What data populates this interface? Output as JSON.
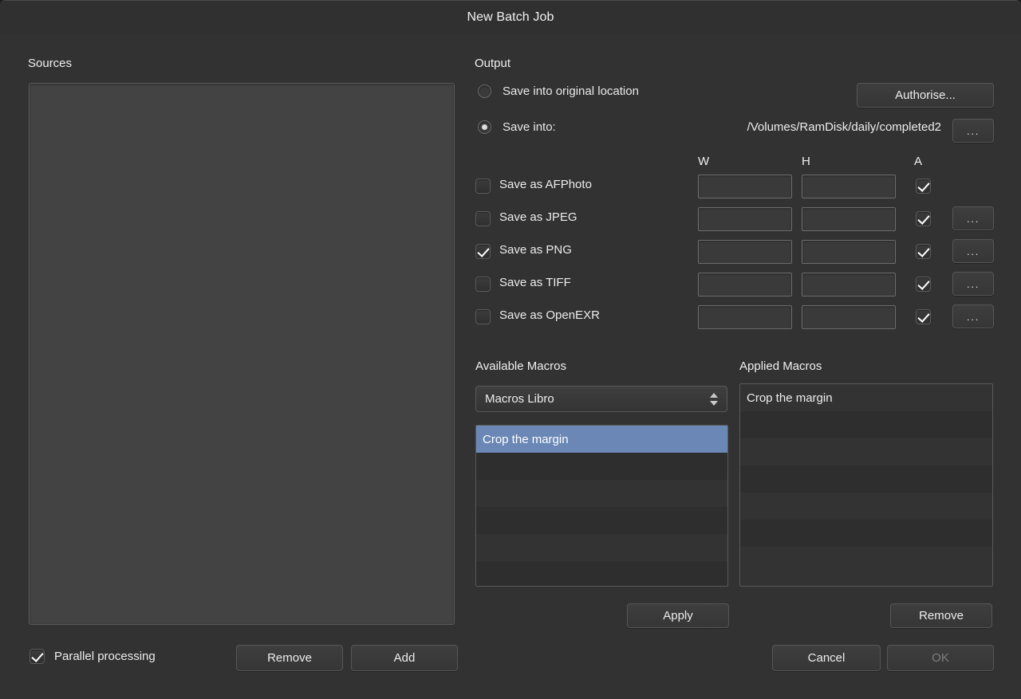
{
  "window": {
    "title": "New Batch Job"
  },
  "sources": {
    "label": "Sources",
    "items": []
  },
  "output": {
    "label": "Output",
    "save_original_label": "Save into original location",
    "save_original_selected": false,
    "save_into_label": "Save into:",
    "save_into_selected": true,
    "save_path": "/Volumes/RamDisk/daily/completed2",
    "authorise_label": "Authorise...",
    "path_browse_label": "...",
    "columns": {
      "w": "W",
      "h": "H",
      "a": "A"
    },
    "formats": [
      {
        "label": "Save as AFPhoto",
        "checked": false,
        "w": "",
        "h": "",
        "alpha": true,
        "has_options": false,
        "options_label": "..."
      },
      {
        "label": "Save as JPEG",
        "checked": false,
        "w": "",
        "h": "",
        "alpha": true,
        "has_options": true,
        "options_label": "..."
      },
      {
        "label": "Save as PNG",
        "checked": true,
        "w": "",
        "h": "",
        "alpha": true,
        "has_options": true,
        "options_label": "..."
      },
      {
        "label": "Save as TIFF",
        "checked": false,
        "w": "",
        "h": "",
        "alpha": true,
        "has_options": true,
        "options_label": "..."
      },
      {
        "label": "Save as OpenEXR",
        "checked": false,
        "w": "",
        "h": "",
        "alpha": true,
        "has_options": true,
        "options_label": "..."
      }
    ]
  },
  "macros": {
    "available_label": "Available Macros",
    "applied_label": "Applied Macros",
    "library_selected": "Macros Libro",
    "available_items": [
      {
        "label": "Crop the margin",
        "selected": true
      }
    ],
    "available_empty_rows": 5,
    "applied_items": [
      {
        "label": "Crop the margin",
        "selected": false
      }
    ],
    "applied_empty_rows": 6,
    "apply_label": "Apply",
    "remove_label": "Remove"
  },
  "footer": {
    "parallel_label": "Parallel processing",
    "parallel_checked": true,
    "remove_label": "Remove",
    "add_label": "Add",
    "cancel_label": "Cancel",
    "ok_label": "OK",
    "ok_enabled": false
  },
  "colors": {
    "window_bg": "#323232",
    "panel_bg": "#434343",
    "list_bg": "#333333",
    "list_alt_bg": "#2e2e2e",
    "selection_blue": "#6a87b5",
    "text": "#ededed",
    "disabled_text": "#7d7d7d",
    "border": "#5a5a5a"
  }
}
